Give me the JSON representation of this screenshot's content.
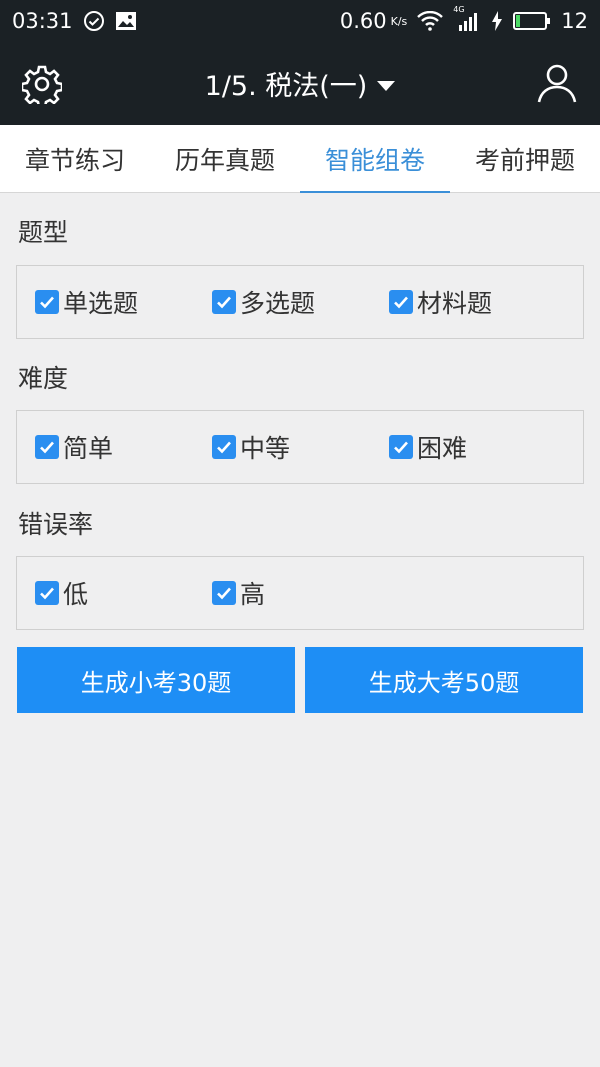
{
  "status_bar": {
    "time": "03:31",
    "net_speed": "0.60",
    "net_unit": "K/s",
    "network_label": "4G",
    "battery_level": "12"
  },
  "app_bar": {
    "title": "1/5. 税法(一)"
  },
  "tabs": [
    {
      "label": "章节练习",
      "active": false
    },
    {
      "label": "历年真题",
      "active": false
    },
    {
      "label": "智能组卷",
      "active": true
    },
    {
      "label": "考前押题",
      "active": false
    }
  ],
  "sections": {
    "type": {
      "label": "题型",
      "options": [
        {
          "label": "单选题",
          "checked": true
        },
        {
          "label": "多选题",
          "checked": true
        },
        {
          "label": "材料题",
          "checked": true
        }
      ]
    },
    "difficulty": {
      "label": "难度",
      "options": [
        {
          "label": "简单",
          "checked": true
        },
        {
          "label": "中等",
          "checked": true
        },
        {
          "label": "困难",
          "checked": true
        }
      ]
    },
    "error_rate": {
      "label": "错误率",
      "options": [
        {
          "label": "低",
          "checked": true
        },
        {
          "label": "高",
          "checked": true
        }
      ]
    }
  },
  "buttons": {
    "small_exam": "生成小考30题",
    "big_exam": "生成大考50题"
  },
  "colors": {
    "accent": "#1e8ef5",
    "tab_active": "#3a8fd8",
    "bar_bg": "#1b2125",
    "page_bg": "#efeff0"
  }
}
